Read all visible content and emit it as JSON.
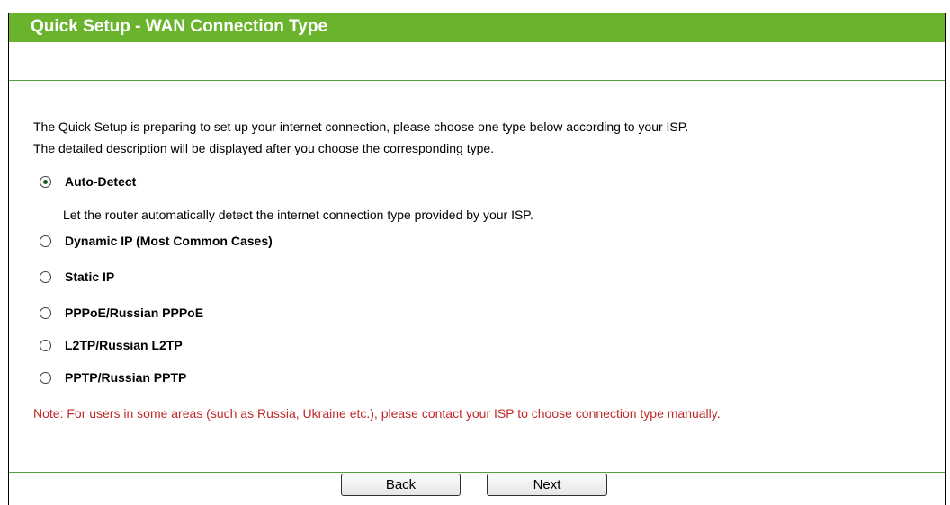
{
  "title": "Quick Setup - WAN Connection Type",
  "intro": {
    "line1": "The Quick Setup is preparing to set up your internet connection, please choose one type below according to your ISP.",
    "line2": "The detailed description will be displayed after you choose the corresponding type."
  },
  "options": [
    {
      "label": "Auto-Detect",
      "selected": true
    },
    {
      "label": "Dynamic IP (Most Common Cases)",
      "selected": false
    },
    {
      "label": "Static IP",
      "selected": false
    },
    {
      "label": "PPPoE/Russian PPPoE",
      "selected": false
    },
    {
      "label": "L2TP/Russian L2TP",
      "selected": false
    },
    {
      "label": "PPTP/Russian PPTP",
      "selected": false
    }
  ],
  "auto_detect_description": "Let the router automatically detect the internet connection type provided by your ISP.",
  "note": "Note: For users in some areas (such as Russia, Ukraine etc.), please contact your ISP to choose connection type manually.",
  "buttons": {
    "back": "Back",
    "next": "Next"
  },
  "colors": {
    "title_bar": "#6ab42d",
    "divider": "#55a03c",
    "note_text": "#bf2a2a"
  }
}
